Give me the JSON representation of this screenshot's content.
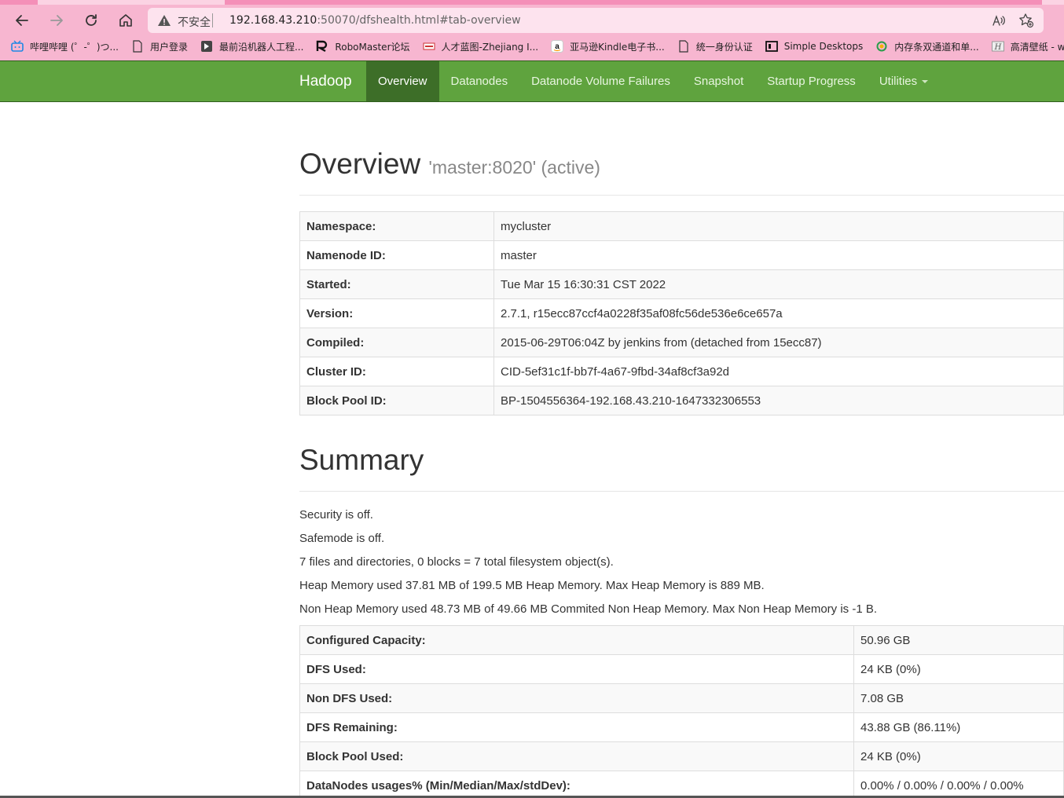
{
  "browser": {
    "insecure_label": "不安全",
    "url_host": "192.168.43.210",
    "url_rest": ":50070/dfshealth.html#tab-overview",
    "bookmarks": [
      {
        "icon": "bilibili-icon",
        "label": "哔哩哔哩 (゜-゜)つ..."
      },
      {
        "icon": "page-icon",
        "label": "用户登录"
      },
      {
        "icon": "robot-icon",
        "label": "最前沿机器人工程..."
      },
      {
        "icon": "robomaster-icon",
        "label": "RoboMaster论坛"
      },
      {
        "icon": "site-icon",
        "label": "人才蓝图-Zhejiang I..."
      },
      {
        "icon": "amazon-icon",
        "label": "亚马逊Kindle电子书..."
      },
      {
        "icon": "page-icon",
        "label": "统一身份认证"
      },
      {
        "icon": "simple-desktops-icon",
        "label": "Simple Desktops"
      },
      {
        "icon": "site-icon",
        "label": "内存条双通道和单..."
      },
      {
        "icon": "wallhaven-icon",
        "label": "高清壁纸 - wallhave..."
      }
    ]
  },
  "navbar": {
    "brand": "Hadoop",
    "items": [
      {
        "label": "Overview",
        "active": true
      },
      {
        "label": "Datanodes"
      },
      {
        "label": "Datanode Volume Failures"
      },
      {
        "label": "Snapshot"
      },
      {
        "label": "Startup Progress"
      },
      {
        "label": "Utilities",
        "dropdown": true
      }
    ]
  },
  "overview": {
    "title": "Overview",
    "subtitle": "'master:8020' (active)",
    "rows": [
      {
        "key": "Namespace:",
        "value": "mycluster"
      },
      {
        "key": "Namenode ID:",
        "value": "master"
      },
      {
        "key": "Started:",
        "value": "Tue Mar 15 16:30:31 CST 2022"
      },
      {
        "key": "Version:",
        "value": "2.7.1, r15ecc87ccf4a0228f35af08fc56de536e6ce657a"
      },
      {
        "key": "Compiled:",
        "value": "2015-06-29T06:04Z by jenkins from (detached from 15ecc87)"
      },
      {
        "key": "Cluster ID:",
        "value": "CID-5ef31c1f-bb7f-4a67-9fbd-34af8cf3a92d"
      },
      {
        "key": "Block Pool ID:",
        "value": "BP-1504556364-192.168.43.210-1647332306553"
      }
    ]
  },
  "summary": {
    "title": "Summary",
    "lines": [
      "Security is off.",
      "Safemode is off.",
      "7 files and directories, 0 blocks = 7 total filesystem object(s).",
      "Heap Memory used 37.81 MB of 199.5 MB Heap Memory. Max Heap Memory is 889 MB.",
      "Non Heap Memory used 48.73 MB of 49.66 MB Commited Non Heap Memory. Max Non Heap Memory is -1 B."
    ],
    "rows": [
      {
        "key": "Configured Capacity:",
        "value": "50.96 GB"
      },
      {
        "key": "DFS Used:",
        "value": "24 KB (0%)"
      },
      {
        "key": "Non DFS Used:",
        "value": "7.08 GB"
      },
      {
        "key": "DFS Remaining:",
        "value": "43.88 GB (86.11%)"
      },
      {
        "key": "Block Pool Used:",
        "value": "24 KB (0%)"
      },
      {
        "key": "DataNodes usages% (Min/Median/Max/stdDev):",
        "value": "0.00% / 0.00% / 0.00% / 0.00%"
      }
    ]
  },
  "colors": {
    "navbar": "#5fa33e",
    "navbar_active": "#3d6e28",
    "browser_chrome": "#f7b6d0"
  }
}
